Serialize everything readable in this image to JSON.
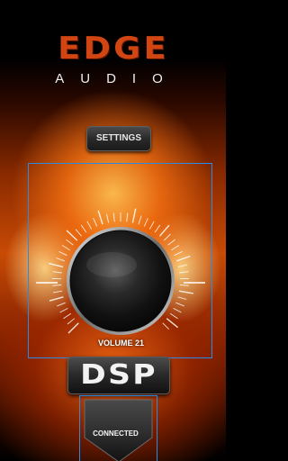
{
  "logo": {
    "brand_top": "EDGE",
    "brand_bottom": "AUDIO"
  },
  "settings": {
    "label": "SETTINGS"
  },
  "volume": {
    "label": "VOLUME 21",
    "level": 21
  },
  "dsp": {
    "label": "DSP"
  },
  "status": {
    "connected_label": "CONNECTED"
  },
  "colors": {
    "accent_orange": "#d04512",
    "frame_blue": "#2a8be0"
  }
}
